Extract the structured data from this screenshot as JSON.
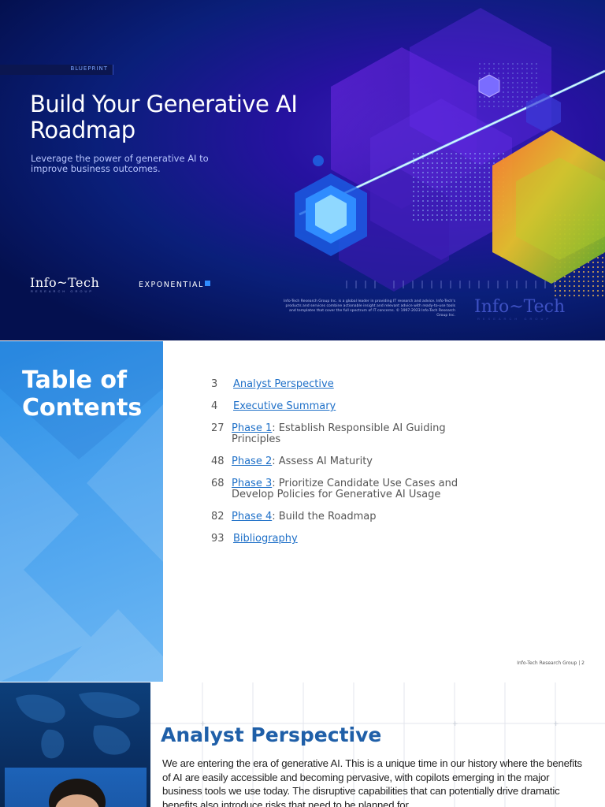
{
  "cover": {
    "badge": "BLUEPRINT",
    "title": "Build Your Generative AI Roadmap",
    "subtitle": "Leverage the power of generative AI to improve business outcomes.",
    "logo_infotech": "Info~Tech",
    "logo_infotech_sub": "RESEARCH GROUP",
    "logo_exponential": "EXPONENTIAL",
    "legal_text": "Info-Tech Research Group Inc. is a global leader in providing IT research and advice. Info-Tech's products and services combine actionable insight and relevant advice with ready-to-use tools and templates that cover the full spectrum of IT concerns. © 1997-2023 Info-Tech Research Group Inc.",
    "watermark": "Info~Tech",
    "watermark_sub": "RESEARCH GROUP",
    "colors": {
      "navy": "#04104f",
      "purple": "#3a1fb8",
      "cyan": "#2fb3ff"
    }
  },
  "toc": {
    "heading": "Table of Contents",
    "items": [
      {
        "page": "3",
        "link": "Analyst Perspective",
        "rest": ""
      },
      {
        "page": "4",
        "link": "Executive Summary",
        "rest": ""
      },
      {
        "page": "27",
        "link": "Phase 1",
        "rest": ": Establish Responsible AI Guiding Principles"
      },
      {
        "page": "48",
        "link": "Phase 2",
        "rest": ": Assess AI Maturity"
      },
      {
        "page": "68",
        "link": "Phase 3",
        "rest": ": Prioritize Candidate Use Cases and Develop Policies for Generative AI Usage"
      },
      {
        "page": "82",
        "link": "Phase 4",
        "rest": ": Build the Roadmap"
      },
      {
        "page": "93",
        "link": "Bibliography",
        "rest": ""
      }
    ],
    "footer": "Info-Tech Research Group  |  2",
    "colors": {
      "side": "#4aa2ee",
      "link": "#1f70c8"
    }
  },
  "analyst": {
    "title": "Analyst Perspective",
    "body": "We are entering the era of generative AI. This is a unique time in our history where the benefits of AI are easily accessible and becoming pervasive, with copilots emerging in the major business tools we use today. The disruptive capabilities that can potentially drive dramatic benefits also introduce risks that need to be planned for."
  }
}
